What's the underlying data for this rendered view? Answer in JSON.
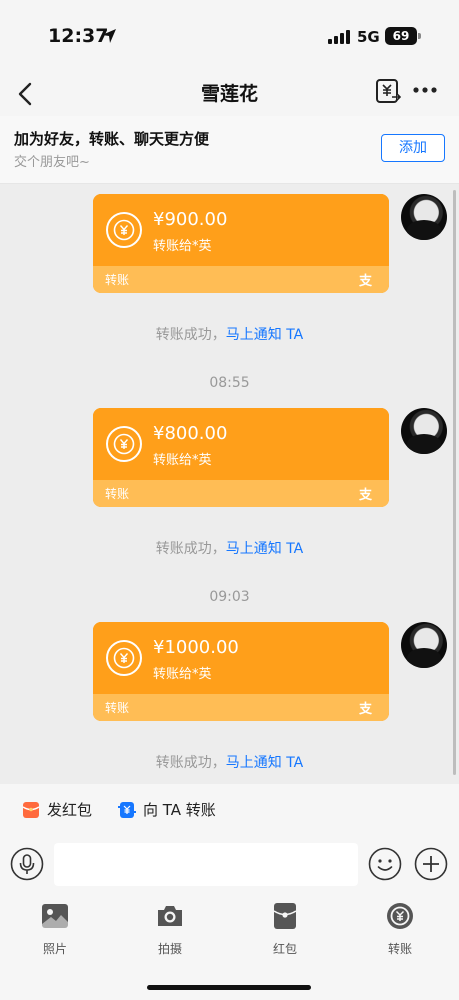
{
  "status_bar": {
    "time": "12:37",
    "network": "5G",
    "battery": "69"
  },
  "nav": {
    "title": "雪莲花"
  },
  "banner": {
    "title": "加为好友，转账、聊天更方便",
    "subtitle": "交个朋友吧~",
    "add_label": "添加"
  },
  "messages": [
    {
      "amount": "¥900.00",
      "recipient": "转账给*英",
      "label": "转账",
      "brand": "支",
      "notice": "转账成功，",
      "notice_link": "马上通知 TA"
    },
    {
      "timestamp": "08:55"
    },
    {
      "amount": "¥800.00",
      "recipient": "转账给*英",
      "label": "转账",
      "brand": "支",
      "notice": "转账成功，",
      "notice_link": "马上通知 TA"
    },
    {
      "timestamp": "09:03"
    },
    {
      "amount": "¥1000.00",
      "recipient": "转账给*英",
      "label": "转账",
      "brand": "支",
      "notice": "转账成功，",
      "notice_link": "马上通知 TA"
    }
  ],
  "quick_actions": [
    {
      "label": "发红包",
      "icon": "red-packet-icon"
    },
    {
      "label": "向 TA 转账",
      "icon": "transfer-icon"
    }
  ],
  "input": {
    "placeholder": ""
  },
  "tools": [
    {
      "label": "照片",
      "icon": "photo-icon"
    },
    {
      "label": "拍摄",
      "icon": "camera-icon"
    },
    {
      "label": "红包",
      "icon": "red-packet-icon"
    },
    {
      "label": "转账",
      "icon": "transfer-icon"
    }
  ],
  "colors": {
    "card": "#ff9f1a",
    "card_footer": "#ffbd55",
    "link": "#1677ff",
    "background": "#ededed"
  }
}
